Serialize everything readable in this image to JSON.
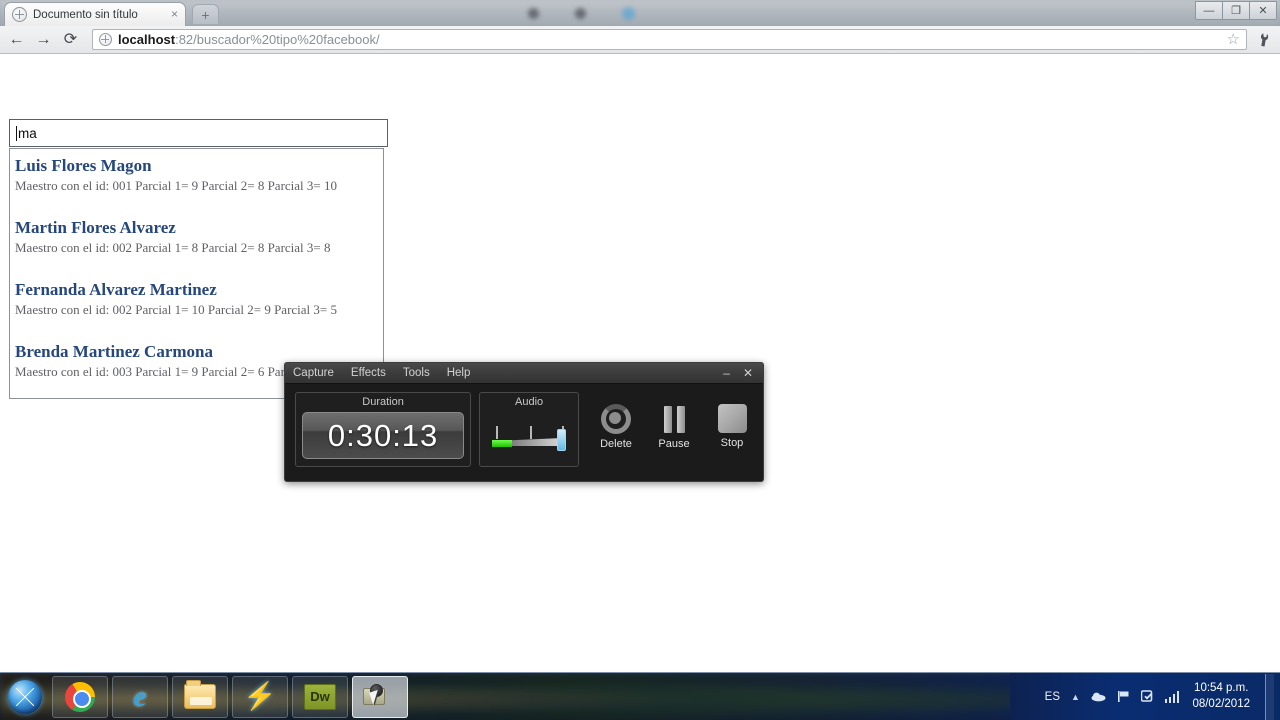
{
  "browser": {
    "tab": {
      "title": "Documento sin título",
      "favicon": "globe-icon",
      "close": "×"
    },
    "newtab_label": "+",
    "window_controls": {
      "minimize": "—",
      "restore": "❐",
      "close": "✕"
    },
    "toolbar": {
      "back": "←",
      "forward": "→",
      "reload": "⟳",
      "star": "☆",
      "wrench": "🔧",
      "url_host": "localhost",
      "url_path": ":82/buscador%20tipo%20facebook/"
    }
  },
  "page": {
    "search": {
      "value": "ma",
      "placeholder": ""
    },
    "results": [
      {
        "name": "Luis Flores Magon",
        "detail": "Maestro con el id: 001 Parcial 1= 9 Parcial 2= 8 Parcial 3= 10"
      },
      {
        "name": "Martin Flores Alvarez",
        "detail": "Maestro con el id: 002 Parcial 1= 8 Parcial 2= 8 Parcial 3= 8"
      },
      {
        "name": "Fernanda Alvarez Martinez",
        "detail": "Maestro con el id: 002 Parcial 1= 10 Parcial 2= 9 Parcial 3= 5"
      },
      {
        "name": "Brenda Martinez Carmona",
        "detail": "Maestro con el id: 003 Parcial 1= 9 Parcial 2= 6 Parcial 3= 5"
      }
    ],
    "link_color": "#26477d"
  },
  "recorder": {
    "menu": [
      "Capture",
      "Effects",
      "Tools",
      "Help"
    ],
    "window_controls": {
      "minimize": "–",
      "close": "✕"
    },
    "duration": {
      "label": "Duration",
      "value": "0:30:13"
    },
    "audio": {
      "label": "Audio"
    },
    "controls": [
      {
        "label": "Delete",
        "icon": "delete-icon"
      },
      {
        "label": "Pause",
        "icon": "pause-icon"
      },
      {
        "label": "Stop",
        "icon": "stop-icon"
      }
    ]
  },
  "taskbar": {
    "start": "start-orb",
    "items": [
      {
        "name": "chrome",
        "label": "Google Chrome"
      },
      {
        "name": "internet-explorer",
        "label": "Internet Explorer"
      },
      {
        "name": "file-explorer",
        "label": "Explorador de Windows"
      },
      {
        "name": "flash-app",
        "label": "Flash"
      },
      {
        "name": "dreamweaver",
        "label": "Dw"
      },
      {
        "name": "screen-recorder",
        "label": "Screen Recorder"
      }
    ],
    "tray": {
      "language": "ES",
      "arrow": "▲",
      "clock_time": "10:54 p.m.",
      "clock_date": "08/02/2012"
    }
  }
}
